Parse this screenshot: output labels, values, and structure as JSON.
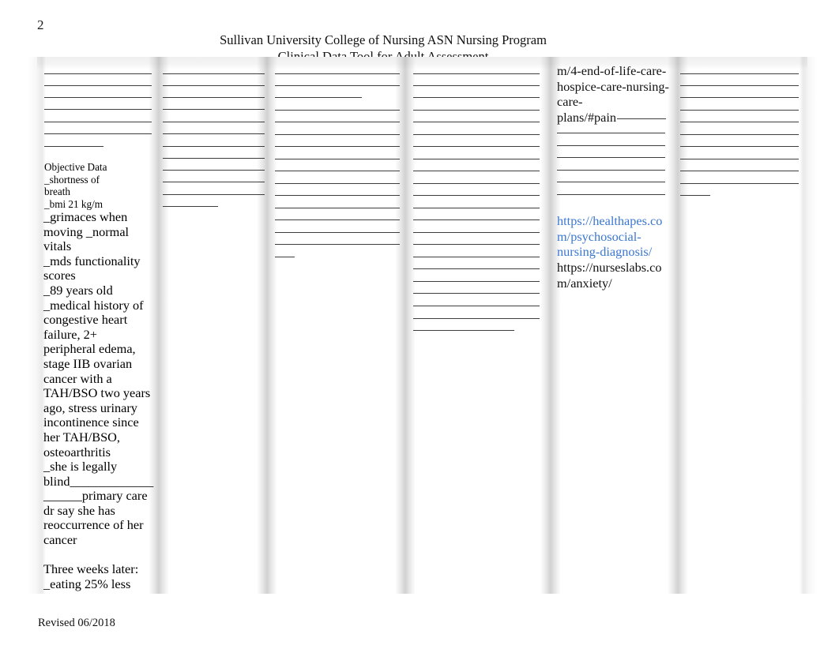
{
  "document": {
    "page_number": "2",
    "header_line1": "Sullivan University College of Nursing ASN Nursing Program",
    "header_line2": "Clinical Data Tool for Adult Assessment",
    "footer": "Revised 06/2018"
  },
  "link_color": "#3a77d1",
  "rule_color": "#3d3d3d",
  "columns": [
    {
      "id": "column-1",
      "name": "objective-data-column",
      "entries": [
        {
          "name": "objective-data-heading-block",
          "style": "small",
          "text": "Objective Data\n_shortness of\nbreath\n_bmi 21 kg/m"
        },
        {
          "name": "objective-data-narrative",
          "style": "body",
          "text": "_grimaces when\nmoving _normal\nvitals\n_mds functionality\nscores\n_89 years old\n_medical history of\ncongestive heart\nfailure, 2+\nperipheral edema,\nstage IIB ovarian\ncancer with a\nTAH/BSO two years\nago, stress urinary\nincontinence since\nher TAH/BSO,\nosteoarthritis\n_she is legally\nblind_____________\n______primary care\ndr say she has\nreoccurrence of her\ncancer"
        },
        {
          "name": "three-weeks-later-note",
          "style": "body",
          "text": "Three weeks later:\n_eating 25% less"
        }
      ]
    },
    {
      "id": "column-2",
      "name": "blank-lines-column-2",
      "entries": []
    },
    {
      "id": "column-3",
      "name": "blank-lines-column-3",
      "entries": []
    },
    {
      "id": "column-4",
      "name": "blank-lines-column-4",
      "entries": []
    },
    {
      "id": "column-5",
      "name": "references-column",
      "entries": [
        {
          "name": "hospice-care-plan-url-fragment",
          "style": "url",
          "text": "m/4-end-of-life-care-\nhospice-care-nursing-\ncare-\nplans/#pain"
        },
        {
          "name": "healthapes-psychosocial-link",
          "style": "url",
          "text": "https://healthapes.com/psychosocial-nursing-diagnosis/"
        },
        {
          "name": "nurseslabs-anxiety-link",
          "style": "url",
          "text": "https://nurseslabs.com/anxiety/"
        }
      ]
    },
    {
      "id": "column-6",
      "name": "blank-lines-column-6",
      "entries": []
    }
  ]
}
